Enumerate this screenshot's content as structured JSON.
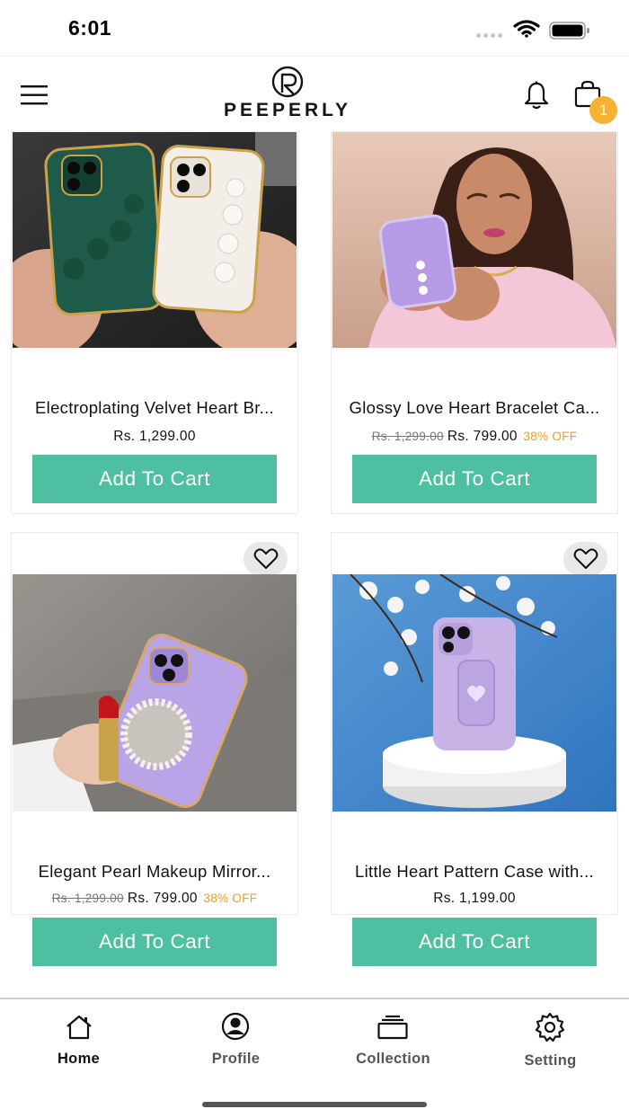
{
  "status": {
    "time": "6:01"
  },
  "header": {
    "brand": "PEEPERLY",
    "cart_count": "1"
  },
  "products": [
    {
      "title": "Electroplating Velvet Heart Br...",
      "price_old": "",
      "price": "Rs. 1,299.00",
      "discount": "",
      "button": "Add To Cart",
      "has_wishlist": false
    },
    {
      "title": "Glossy Love Heart Bracelet Ca...",
      "price_old": "Rs. 1,299.00",
      "price": "Rs. 799.00",
      "discount": "38% OFF",
      "button": "Add To Cart",
      "has_wishlist": false
    },
    {
      "title": "Elegant Pearl Makeup Mirror...",
      "price_old": "Rs. 1,299.00",
      "price": "Rs. 799.00",
      "discount": "38% OFF",
      "button": "Add To Cart",
      "has_wishlist": true
    },
    {
      "title": "Little Heart Pattern Case with...",
      "price_old": "",
      "price": "Rs. 1,199.00",
      "discount": "",
      "button": "Add To Cart",
      "has_wishlist": true
    }
  ],
  "nav": [
    {
      "label": "Home",
      "icon": "home-icon",
      "active": true
    },
    {
      "label": "Profile",
      "icon": "profile-icon",
      "active": false
    },
    {
      "label": "Collection",
      "icon": "collection-icon",
      "active": false
    },
    {
      "label": "Setting",
      "icon": "settings-icon",
      "active": false
    }
  ],
  "colors": {
    "accent": "#4ebfa0",
    "badge": "#f6b232",
    "discount": "#f39c12"
  }
}
